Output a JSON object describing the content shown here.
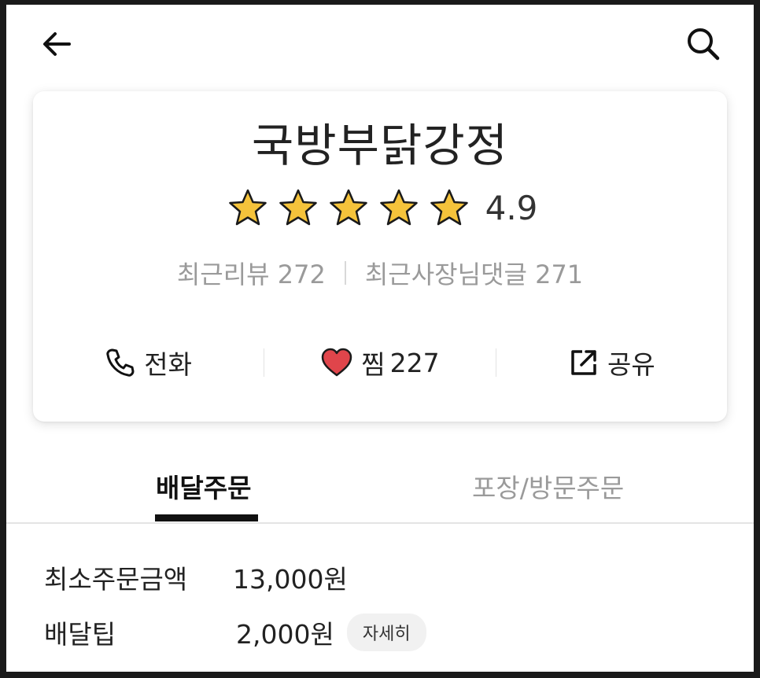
{
  "store": {
    "name": "국방부닭강정",
    "rating": "4.9",
    "stars": 5,
    "recent_reviews": "최근리뷰 272",
    "owner_replies": "최근사장님댓글 271"
  },
  "actions": {
    "call_label": "전화",
    "like_label": "찜",
    "like_count": "227",
    "share_label": "공유"
  },
  "tabs": {
    "delivery": "배달주문",
    "pickup": "포장/방문주문"
  },
  "info": {
    "min_order_label": "최소주문금액",
    "min_order_value": "13,000원",
    "delivery_tip_label": "배달팁",
    "delivery_tip_value": "2,000원",
    "detail_button": "자세히"
  },
  "colors": {
    "star": "#f5c33b",
    "heart": "#e0454b",
    "text_primary": "#222222",
    "text_muted": "#9a9a9a"
  },
  "icons": [
    "back-arrow-icon",
    "search-icon",
    "star-icon",
    "phone-icon",
    "heart-icon",
    "share-icon"
  ]
}
